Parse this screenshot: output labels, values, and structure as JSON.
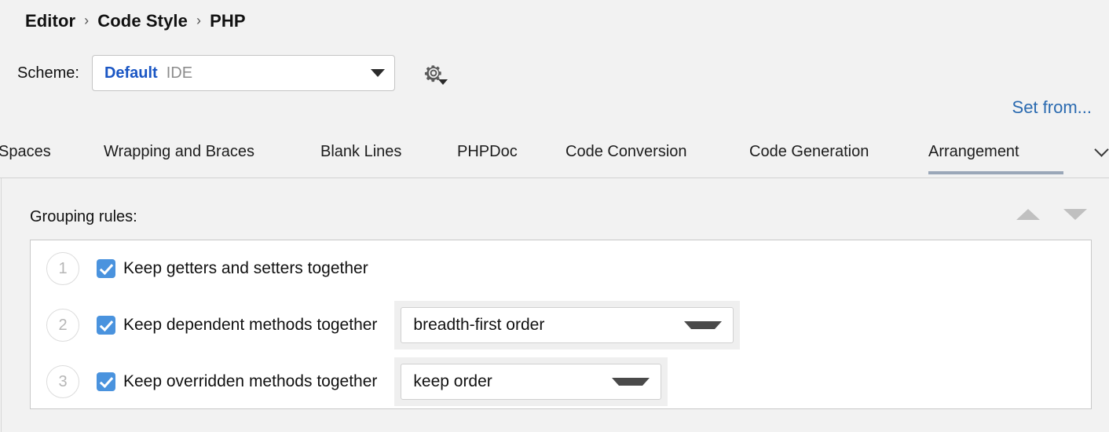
{
  "breadcrumb": {
    "separator": "›",
    "items": [
      "Editor",
      "Code Style",
      "PHP"
    ]
  },
  "scheme": {
    "label": "Scheme:",
    "name": "Default",
    "kind": "IDE",
    "gear_icon": "gear-icon",
    "dropdown_icon": "chevron-down-icon"
  },
  "links": {
    "set_from": "Set from..."
  },
  "tabs": {
    "items": [
      {
        "label": "Spaces",
        "selected": false
      },
      {
        "label": "Wrapping and Braces",
        "selected": false
      },
      {
        "label": "Blank Lines",
        "selected": false
      },
      {
        "label": "PHPDoc",
        "selected": false
      },
      {
        "label": "Code Conversion",
        "selected": false
      },
      {
        "label": "Code Generation",
        "selected": false
      },
      {
        "label": "Arrangement",
        "selected": true
      }
    ],
    "overflow_icon": "chevron-down-icon"
  },
  "grouping": {
    "title": "Grouping rules:",
    "move_up_icon": "triangle-up-icon",
    "move_down_icon": "triangle-down-icon",
    "rules": [
      {
        "index": "1",
        "checked": true,
        "label": "Keep getters and setters together",
        "order": null
      },
      {
        "index": "2",
        "checked": true,
        "label": "Keep dependent methods together",
        "order": "breadth-first order"
      },
      {
        "index": "3",
        "checked": true,
        "label": "Keep overridden methods together",
        "order": "keep order"
      }
    ]
  },
  "colors": {
    "background": "#f2f2f2",
    "accent_blue": "#1a56c4",
    "link_blue": "#2a6ab0",
    "checkbox_blue": "#4a93de",
    "tab_underline": "#9aa7b8"
  }
}
